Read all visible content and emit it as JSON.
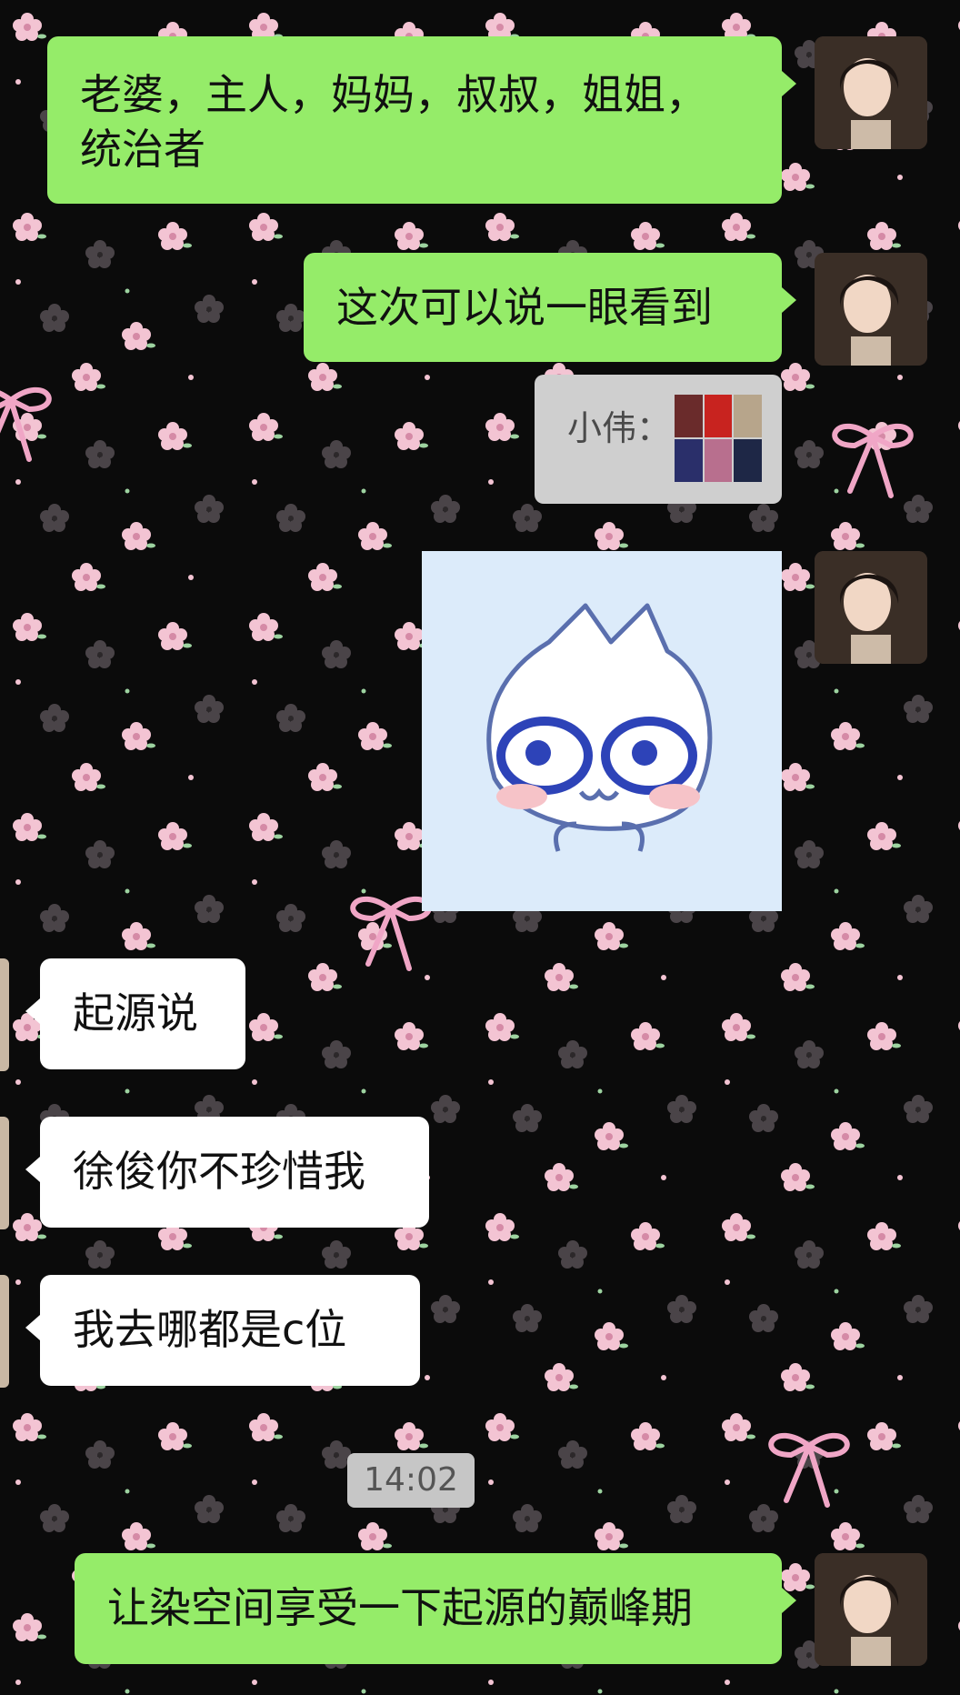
{
  "messages": [
    {
      "id": "m1",
      "side": "out",
      "text_line1": "老婆，主人，妈妈，叔叔，姐姐，",
      "text_line2": "统治者"
    },
    {
      "id": "m2",
      "side": "out",
      "text": "这次可以说一眼看到"
    },
    {
      "id": "m3",
      "side": "quote",
      "sender_label": "小伟：",
      "attachment": "image-collage-thumbnail"
    },
    {
      "id": "m4",
      "side": "out",
      "type": "sticker",
      "sticker": "crying-cat-sticker"
    },
    {
      "id": "m5",
      "side": "in",
      "text": "起源说"
    },
    {
      "id": "m6",
      "side": "in",
      "text": "徐俊你不珍惜我"
    },
    {
      "id": "m7",
      "side": "in",
      "text": "我去哪都是c位"
    },
    {
      "id": "m8",
      "side": "out",
      "text": "让染空间享受一下起源的巅峰期"
    }
  ],
  "timestamp": "14:02",
  "colors": {
    "outgoing_bubble": "#95ec69",
    "incoming_bubble": "#ffffff",
    "background": "#0b0b0b",
    "flower_pink": "#f3c4d3",
    "flower_grey": "#4a4448",
    "ribbon": "#f0a6c6"
  },
  "icons": [
    "user-avatar",
    "contact-avatar",
    "sticker-cat",
    "image-thumbnail"
  ]
}
